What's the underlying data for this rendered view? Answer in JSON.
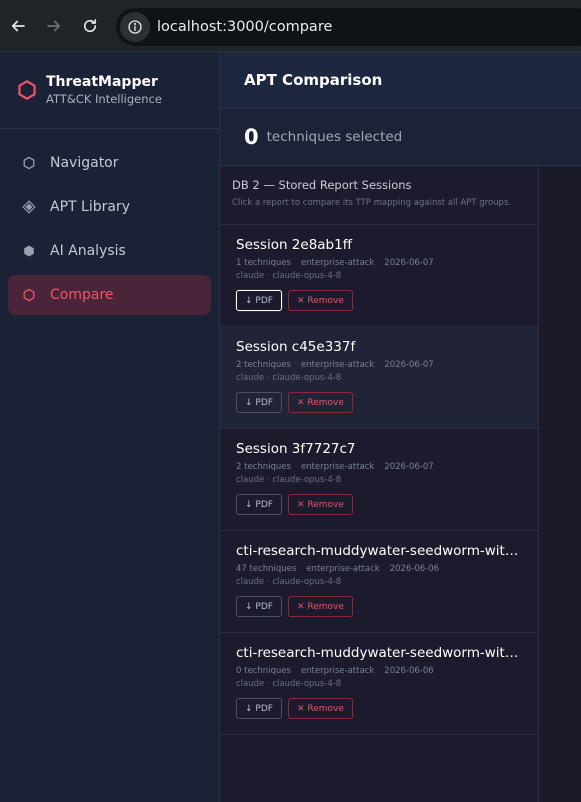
{
  "browser": {
    "url": "localhost:3000/compare"
  },
  "brand": {
    "title": "ThreatMapper",
    "subtitle": "ATT&CK Intelligence"
  },
  "nav": [
    {
      "label": "Navigator",
      "icon": "hexagon-outline-icon",
      "active": false
    },
    {
      "label": "APT Library",
      "icon": "diamond-icon",
      "active": false
    },
    {
      "label": "AI Analysis",
      "icon": "hexagon-filled-icon",
      "active": false
    },
    {
      "label": "Compare",
      "icon": "hexagon-outline-icon",
      "active": true
    }
  ],
  "page": {
    "title": "APT Comparison",
    "selected_count": "0",
    "selected_label": "techniques selected"
  },
  "panel": {
    "title": "DB 2 — Stored Report Sessions",
    "description": "Click a report to compare its TTP mapping against all APT groups."
  },
  "sessions": [
    {
      "title": "Session 2e8ab1ff",
      "techniques": "1 techniques",
      "domain": "enterprise-attack",
      "date": "2026-06-07",
      "model": "claude · claude-opus-4-8",
      "pdf_label": "↓ PDF",
      "remove_label": "✕ Remove"
    },
    {
      "title": "Session c45e337f",
      "techniques": "2 techniques",
      "domain": "enterprise-attack",
      "date": "2026-06-07",
      "model": "claude · claude-opus-4-8",
      "pdf_label": "↓ PDF",
      "remove_label": "✕ Remove"
    },
    {
      "title": "Session 3f7727c7",
      "techniques": "2 techniques",
      "domain": "enterprise-attack",
      "date": "2026-06-07",
      "model": "claude · claude-opus-4-8",
      "pdf_label": "↓ PDF",
      "remove_label": "✕ Remove"
    },
    {
      "title": "cti-research-muddywater-seedworm-with-…",
      "techniques": "47 techniques",
      "domain": "enterprise-attack",
      "date": "2026-06-06",
      "model": "claude · claude-opus-4-8",
      "pdf_label": "↓ PDF",
      "remove_label": "✕ Remove"
    },
    {
      "title": "cti-research-muddywater-seedworm-with-…",
      "techniques": "0 techniques",
      "domain": "enterprise-attack",
      "date": "2026-06-06",
      "model": "claude · claude-opus-4-8",
      "pdf_label": "↓ PDF",
      "remove_label": "✕ Remove"
    }
  ],
  "colors": {
    "accent": "#f0546c",
    "active_bg": "#4a2438"
  }
}
